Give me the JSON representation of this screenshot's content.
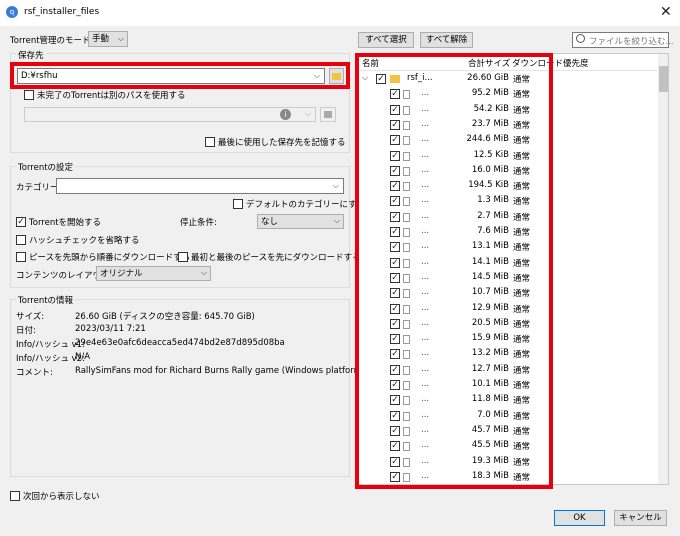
{
  "window": {
    "title": "rsf_installer_files"
  },
  "top": {
    "mode_label": "Torrent管理のモード:",
    "mode_value": "手動",
    "select_all": "すべて選択",
    "deselect_all": "すべて解除",
    "filter_placeholder": "ファイルを絞り込む..."
  },
  "save": {
    "group_title": "保存先",
    "path": "D:¥rsfhu",
    "incomplete_label": "未完了のTorrentは別のパスを使用する",
    "remember_label": "最後に使用した保存先を記憶する"
  },
  "torrent_settings": {
    "group_title": "Torrentの設定",
    "category_label": "カテゴリー:",
    "category_value": "",
    "default_category_label": "デフォルトのカテゴリーにする",
    "start_label": "Torrentを開始する",
    "stop_label": "停止条件:",
    "stop_value": "なし",
    "skip_hash_label": "ハッシュチェックを省略する",
    "sequential_label": "ピースを先頭から順番にダウンロードする",
    "first_last_label": "最初と最後のピースを先にダウンロードする",
    "layout_label": "コンテンツのレイアウト:",
    "layout_value": "オリジナル"
  },
  "torrent_info": {
    "group_title": "Torrentの情報",
    "size_label": "サイズ:",
    "size_value": "26.60 GiB (ディスクの空き容量: 645.70 GiB)",
    "date_label": "日付:",
    "date_value": "2023/03/11 7:21",
    "hash1_label": "Info/ハッシュ v1:",
    "hash1_value": "29e4e63e0afc6deacca5ed474bd2e87d895d08ba",
    "hash2_label": "Info/ハッシュ v2:",
    "hash2_value": "N/A",
    "comment_label": "コメント:",
    "comment_value": "RallySimFans mod for Richard Burns Rally game (Windows platform)"
  },
  "bottom": {
    "dont_show_label": "次回から表示しない",
    "ok": "OK",
    "cancel": "キャンセル"
  },
  "file_tree": {
    "col_name": "名前",
    "col_size": "合計サイズ",
    "col_priority": "ダウンロード優先度",
    "root": {
      "name": "rsf_i...",
      "size": "26.60 GiB",
      "priority": "通常"
    },
    "files": [
      {
        "name": "...",
        "size": "95.2 MiB",
        "priority": "通常"
      },
      {
        "name": "...",
        "size": "54.2 KiB",
        "priority": "通常"
      },
      {
        "name": "...",
        "size": "23.7 MiB",
        "priority": "通常"
      },
      {
        "name": "...",
        "size": "244.6 MiB",
        "priority": "通常"
      },
      {
        "name": "...",
        "size": "12.5 KiB",
        "priority": "通常"
      },
      {
        "name": "...",
        "size": "16.0 MiB",
        "priority": "通常"
      },
      {
        "name": "...",
        "size": "194.5 KiB",
        "priority": "通常"
      },
      {
        "name": "...",
        "size": "1.3 MiB",
        "priority": "通常"
      },
      {
        "name": "...",
        "size": "2.7 MiB",
        "priority": "通常"
      },
      {
        "name": "...",
        "size": "7.6 MiB",
        "priority": "通常"
      },
      {
        "name": "...",
        "size": "13.1 MiB",
        "priority": "通常"
      },
      {
        "name": "...",
        "size": "14.1 MiB",
        "priority": "通常"
      },
      {
        "name": "...",
        "size": "14.5 MiB",
        "priority": "通常"
      },
      {
        "name": "...",
        "size": "10.7 MiB",
        "priority": "通常"
      },
      {
        "name": "...",
        "size": "12.9 MiB",
        "priority": "通常"
      },
      {
        "name": "...",
        "size": "20.5 MiB",
        "priority": "通常"
      },
      {
        "name": "...",
        "size": "15.9 MiB",
        "priority": "通常"
      },
      {
        "name": "...",
        "size": "13.2 MiB",
        "priority": "通常"
      },
      {
        "name": "...",
        "size": "12.7 MiB",
        "priority": "通常"
      },
      {
        "name": "...",
        "size": "10.1 MiB",
        "priority": "通常"
      },
      {
        "name": "...",
        "size": "11.8 MiB",
        "priority": "通常"
      },
      {
        "name": "...",
        "size": "7.0 MiB",
        "priority": "通常"
      },
      {
        "name": "...",
        "size": "45.7 MiB",
        "priority": "通常"
      },
      {
        "name": "...",
        "size": "45.5 MiB",
        "priority": "通常"
      },
      {
        "name": "...",
        "size": "19.3 MiB",
        "priority": "通常"
      },
      {
        "name": "...",
        "size": "18.3 MiB",
        "priority": "通常"
      }
    ]
  },
  "colors": {
    "highlight": "#e8000b",
    "folder": "#f5c342"
  },
  "icons": [
    "app-icon",
    "close-icon",
    "search-icon",
    "folder-icon",
    "file-icon",
    "info-icon",
    "chevron-down-icon"
  ]
}
